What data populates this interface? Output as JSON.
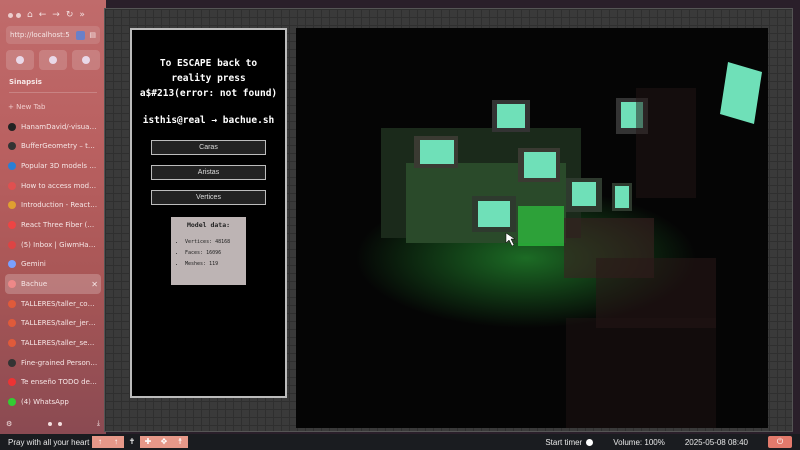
{
  "browser": {
    "url": "http://localhost:5",
    "workspace": "Sinapsis",
    "new_tab_label": "+ New Tab",
    "tabs": [
      {
        "label": "HanamDavid/-visual_co",
        "color": "#222"
      },
      {
        "label": "BufferGeometry – three",
        "color": "#333"
      },
      {
        "label": "Popular 3D models - Sk",
        "color": "#2a7fd4"
      },
      {
        "label": "How to access model fa",
        "color": "#e05050"
      },
      {
        "label": "Introduction - React Thr",
        "color": "#e0a030"
      },
      {
        "label": "React Three Fiber (R3F)",
        "color": "#e44"
      },
      {
        "label": "(5) Inbox | GiwmHanan",
        "color": "#d44"
      },
      {
        "label": "Gemini",
        "color": "#7aa0ff"
      },
      {
        "label": "Bachue",
        "color": "#e88"
      },
      {
        "label": "TALLERES/taller_constr",
        "color": "#e05a3a"
      },
      {
        "label": "TALLERES/taller_jerarq",
        "color": "#e05a3a"
      },
      {
        "label": "TALLERES/taller_segme",
        "color": "#e05a3a"
      },
      {
        "label": "Fine-grained Personal A",
        "color": "#333"
      },
      {
        "label": "Te enseño TODO de Typ",
        "color": "#e33"
      },
      {
        "label": "(4) WhatsApp",
        "color": "#3c3"
      }
    ],
    "active_close": "✕"
  },
  "hud": {
    "title": "To ESCAPE back to\nreality press\na$#213(error: not found)",
    "command": "isthis@real → bachue.sh",
    "btn_faces": "Caras",
    "btn_edges": "Aristas",
    "btn_vertices": "Vertices",
    "model_title": "Model data:",
    "vertices": "Vertices: 48168",
    "faces": "Faces: 16096",
    "meshes": "Meshes: 119"
  },
  "taskbar": {
    "title": "Pray with all your heart",
    "start_timer": "Start timer",
    "volume": "Volume: 100%",
    "datetime": "2025-05-08  08:40"
  },
  "colors": {
    "sidebar": "#b96060",
    "accent": "#e79889",
    "screen_glow": "#6fe0b8",
    "green_light": "#2fbf3f"
  }
}
